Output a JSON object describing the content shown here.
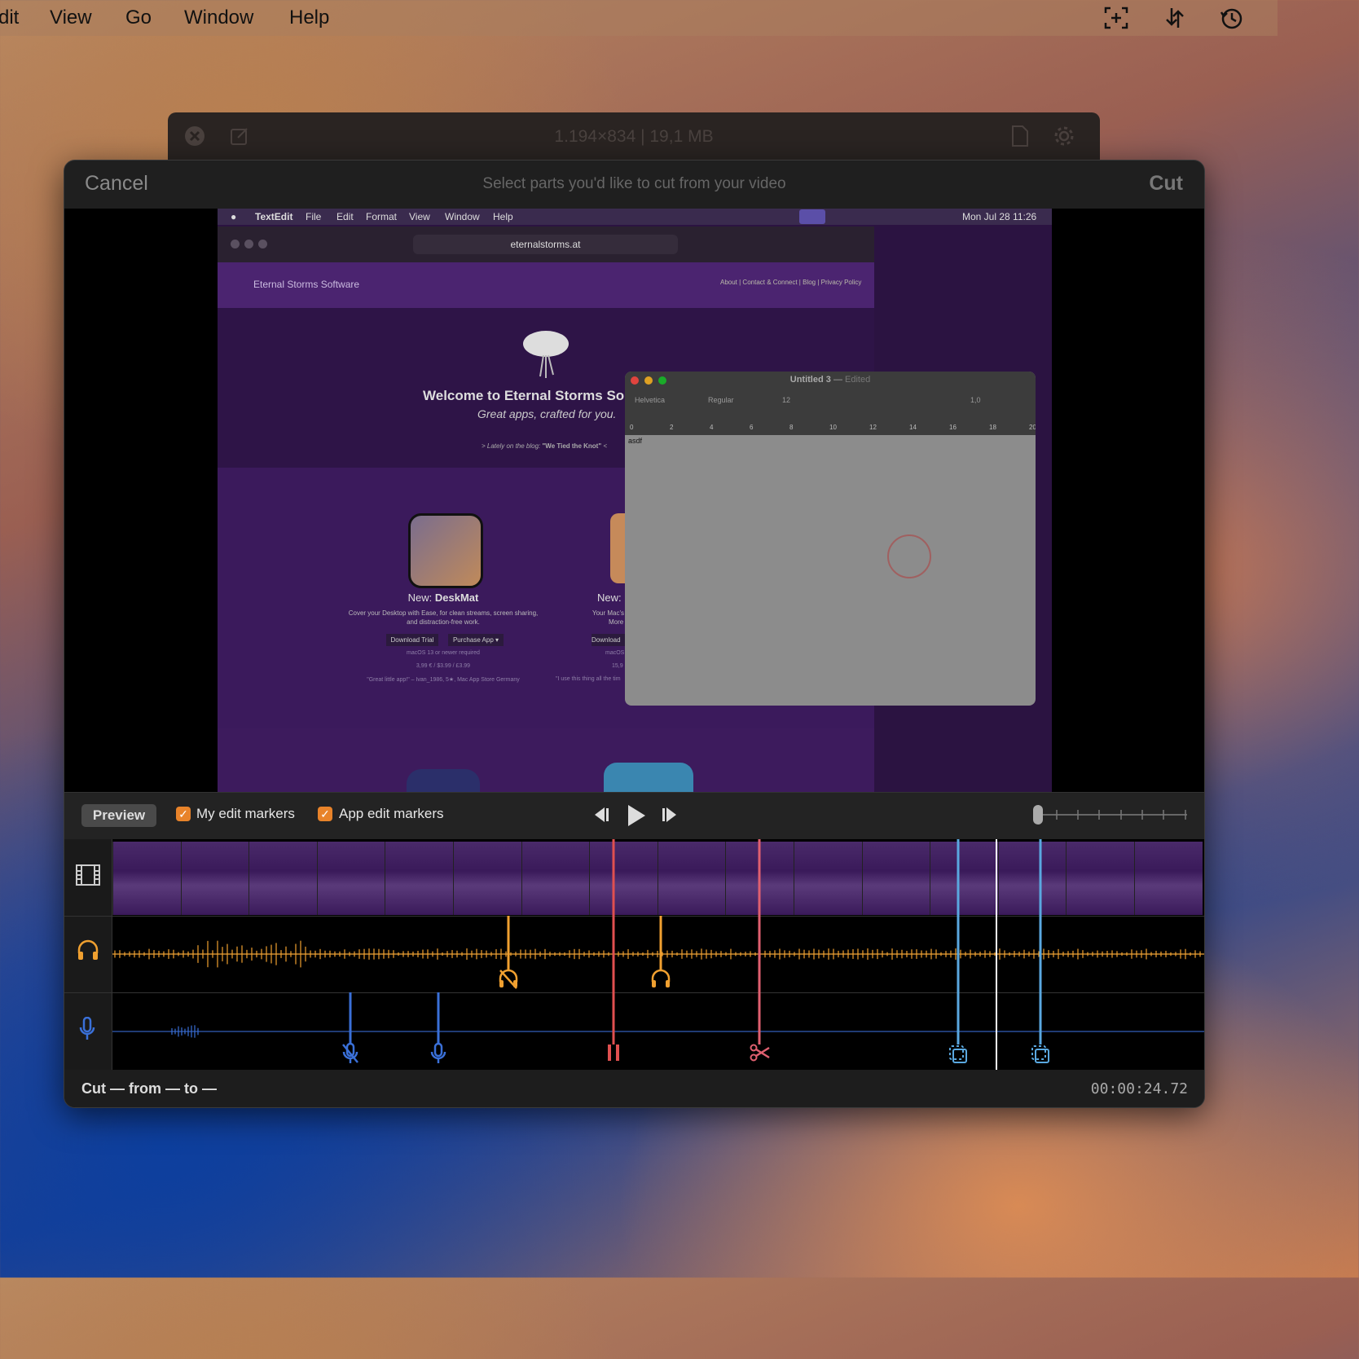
{
  "menubar": {
    "items": [
      "dit",
      "View",
      "Go",
      "Window",
      "Help"
    ],
    "icons": [
      "screenshot-icon",
      "sync-icon",
      "history-icon"
    ]
  },
  "background_window": {
    "title": "1.194×834 | 19,1 MB"
  },
  "dialog": {
    "cancel_label": "Cancel",
    "instruction": "Select parts you'd like to cut from your video",
    "cut_label": "Cut"
  },
  "video": {
    "menubar": {
      "app": "TextEdit",
      "items": [
        "File",
        "Edit",
        "Format",
        "View",
        "Window",
        "Help"
      ],
      "clock": "Mon Jul 28  11:26"
    },
    "safari": {
      "url": "eternalstorms.at",
      "site_name": "Eternal Storms Software",
      "nav_links": "About | Contact & Connect | Blog | Privacy Policy",
      "hero_title": "Welcome to Eternal Storms So",
      "hero_subtitle": "Great apps, crafted for you.",
      "blog_line_prefix": "> Lately on the blog: ",
      "blog_line_title": "\"We Tied the Knot\"",
      "blog_line_suffix": " <",
      "app1": {
        "prefix": "New: ",
        "name": "DeskMat",
        "desc1": "Cover your Desktop with Ease, for clean streams, screen sharing,",
        "desc2": "and distraction-free work.",
        "download": "Download Trial",
        "purchase": "Purchase App ▾",
        "req": "macOS 13 or newer required",
        "price": "3,99 € / $3.99 / £3.99",
        "quote": "\"Great little app!\" – Ivan_1986, 5★, Mac App Store Germany"
      },
      "app2": {
        "prefix": "New:",
        "desc1": "Your Mac's",
        "desc2": "More",
        "download": "Download",
        "req": "macOS",
        "price": "15,9",
        "quote": "\"I use this thing all the tim"
      }
    },
    "textedit": {
      "title": "Untitled 3",
      "title_sep": " — ",
      "edited": "Edited",
      "font": "Helvetica",
      "style": "Regular",
      "size": "12",
      "spacing": "1,0",
      "ruler": [
        "0",
        "2",
        "4",
        "6",
        "8",
        "10",
        "12",
        "14",
        "16",
        "18",
        "20"
      ],
      "content": "asdf"
    }
  },
  "controls": {
    "preview_label": "Preview",
    "my_markers_label": "My edit markers",
    "app_markers_label": "App edit markers",
    "my_markers_checked": true,
    "app_markers_checked": true
  },
  "timeline": {
    "tracks": [
      "video-track",
      "system-audio-track",
      "microphone-track"
    ],
    "markers": [
      {
        "kind": "audio-muted",
        "color": "#f0a030"
      },
      {
        "kind": "audio-on",
        "color": "#f0a030"
      },
      {
        "kind": "mic-muted",
        "color": "#3a70d8"
      },
      {
        "kind": "mic-on",
        "color": "#3a70d8"
      },
      {
        "kind": "pause",
        "color": "#e05050"
      },
      {
        "kind": "cut",
        "color": "#e06070"
      },
      {
        "kind": "area-change",
        "color": "#5aa8e0"
      },
      {
        "kind": "area-change",
        "color": "#5aa8e0"
      }
    ]
  },
  "status": {
    "cut_text": "Cut — from — to —",
    "timecode": "00:00:24.72"
  }
}
